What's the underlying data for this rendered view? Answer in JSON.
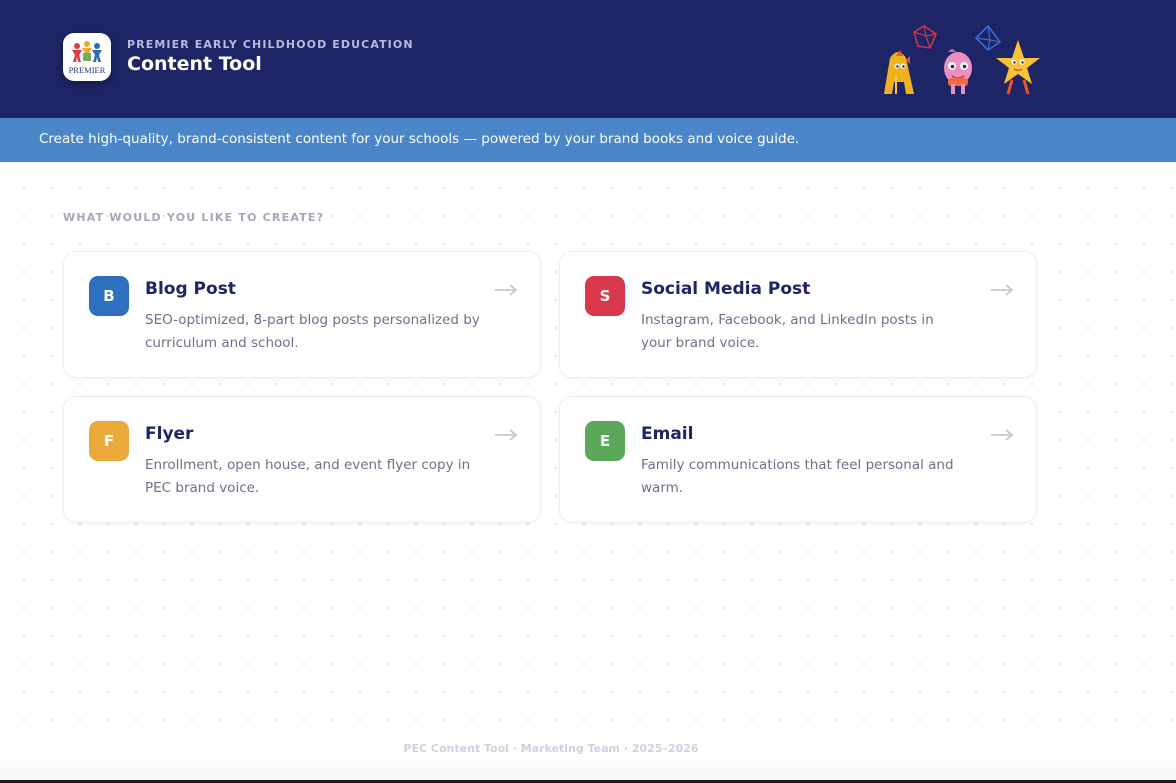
{
  "header": {
    "logo_text": "PREMIER",
    "eyebrow": "PREMIER EARLY CHILDHOOD EDUCATION",
    "title": "Content Tool",
    "background": "#1e2566"
  },
  "tagline": "Create high-quality, brand-consistent content for your schools — powered by your brand books and voice guide.",
  "section_label": "WHAT WOULD YOU LIKE TO CREATE?",
  "cards": [
    {
      "letter": "B",
      "title": "Blog Post",
      "description": "SEO-optimized, 8-part blog posts personalized by curriculum and school.",
      "color": "#2f6fc0",
      "icon": "arrow-right-icon"
    },
    {
      "letter": "S",
      "title": "Social Media Post",
      "description": "Instagram, Facebook, and LinkedIn posts in your brand voice.",
      "color": "#d9384c",
      "icon": "arrow-right-icon"
    },
    {
      "letter": "F",
      "title": "Flyer",
      "description": "Enrollment, open house, and event flyer copy in PEC brand voice.",
      "color": "#eaa93a",
      "icon": "arrow-right-icon"
    },
    {
      "letter": "E",
      "title": "Email",
      "description": "Family communications that feel personal and warm.",
      "color": "#5ca85b",
      "icon": "arrow-right-icon"
    }
  ],
  "footer": "PEC Content Tool · Marketing Team · 2025–2026",
  "colors": {
    "navy": "#1e2566",
    "tagline_blue": "#4a86c8"
  }
}
